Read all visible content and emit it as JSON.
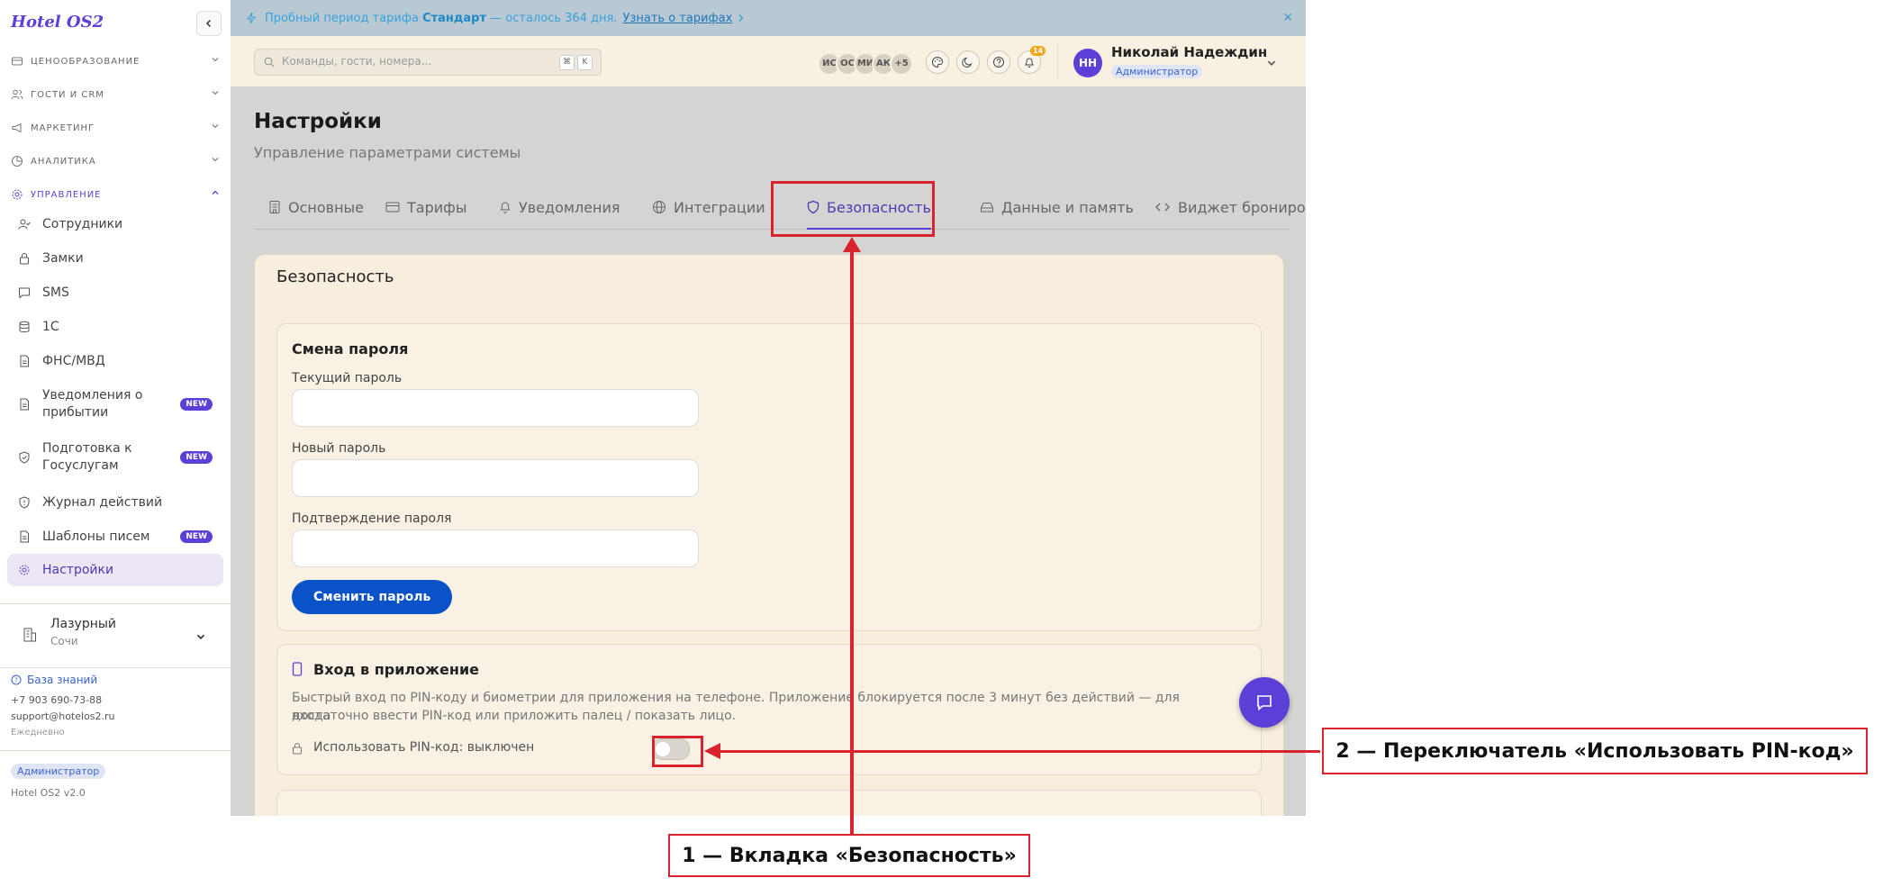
{
  "brand": "Hotel OS2",
  "sidebar": {
    "sections": [
      {
        "label": "ЦЕНООБРАЗОВАНИЕ"
      },
      {
        "label": "ГОСТИ И CRM"
      },
      {
        "label": "МАРКЕТИНГ"
      },
      {
        "label": "АНАЛИТИКА"
      },
      {
        "label": "УПРАВЛЕНИЕ"
      }
    ],
    "items": [
      {
        "label": "Сотрудники"
      },
      {
        "label": "Замки"
      },
      {
        "label": "SMS"
      },
      {
        "label": "1С"
      },
      {
        "label": "ФНС/МВД"
      },
      {
        "label": "Уведомления о прибытии",
        "badge": "NEW"
      },
      {
        "label": "Подготовка к Госуслугам",
        "badge": "NEW"
      },
      {
        "label": "Журнал действий"
      },
      {
        "label": "Шаблоны писем",
        "badge": "NEW"
      },
      {
        "label": "Настройки"
      }
    ],
    "hotel": {
      "name": "Лазурный",
      "city": "Сочи"
    },
    "footer": {
      "kb": "База знаний",
      "phone": "+7 903 690-73-88",
      "email": "support@hotelos2.ru",
      "hours": "Ежедневно",
      "role": "Администратор",
      "version": "Hotel OS2 v2.0"
    }
  },
  "banner": {
    "prefix": "Пробный период тарифа",
    "plan": "Стандарт",
    "suffix": "— осталось 364 дня.",
    "link": "Узнать о тарифах"
  },
  "header": {
    "search_placeholder": "Команды, гости, номера...",
    "kbd1": "⌘",
    "kbd2": "K",
    "avatars": [
      "ИС",
      "ОС",
      "МИ",
      "АК",
      "+5"
    ],
    "notif_count": "14",
    "user_initials": "НН",
    "user_name": "Николай Надеждин",
    "user_role": "Администратор"
  },
  "page": {
    "title": "Настройки",
    "subtitle": "Управление параметрами системы",
    "tabs": [
      {
        "label": "Основные"
      },
      {
        "label": "Тарифы"
      },
      {
        "label": "Уведомления"
      },
      {
        "label": "Интеграции"
      },
      {
        "label": "Безопасность"
      },
      {
        "label": "Данные и память"
      },
      {
        "label": "Виджет бронирова"
      }
    ]
  },
  "security": {
    "title": "Безопасность",
    "password": {
      "title": "Смена пароля",
      "current": "Текущий пароль",
      "new": "Новый пароль",
      "confirm": "Подтверждение пароля",
      "submit": "Сменить пароль"
    },
    "app": {
      "title": "Вход в приложение",
      "desc1": "Быстрый вход по PIN-коду и биометрии для приложения на телефоне. Приложение блокируется после 3 минут без действий — для входа",
      "desc2": "достаточно ввести PIN-код или приложить палец / показать лицо.",
      "pin_label": "Использовать PIN-код: выключен",
      "pin_enabled": false
    }
  },
  "annotations": {
    "callout1": "1 — Вкладка «Безопасность»",
    "callout2": "2 — Переключатель «Использовать PIN-код»",
    "color": "#d9232e"
  },
  "colors": {
    "accent": "#5b3fd6",
    "button": "#0a52c7",
    "annotation": "#d9232e"
  }
}
